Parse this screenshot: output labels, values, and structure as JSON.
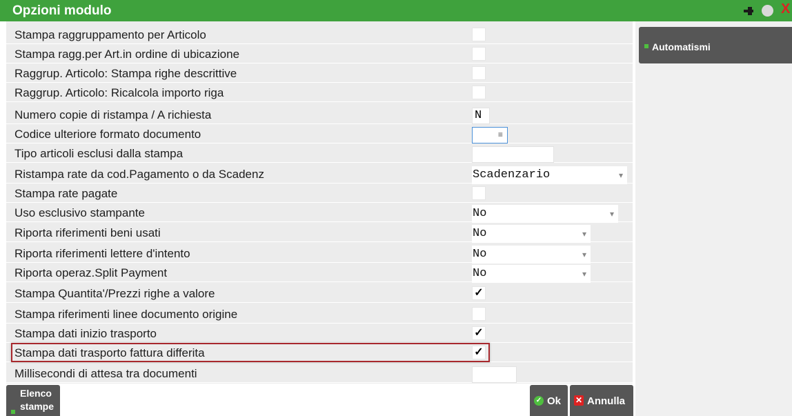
{
  "window": {
    "title": "Opzioni modulo"
  },
  "rows": [
    {
      "label": "Stampa raggruppamento per Articolo",
      "type": "checkbox",
      "checked": false
    },
    {
      "label": "Stampa ragg.per Art.in ordine di ubicazione",
      "type": "checkbox",
      "checked": false
    },
    {
      "label": "Raggrup. Articolo: Stampa righe descrittive",
      "type": "checkbox",
      "checked": false
    },
    {
      "label": "Raggrup. Articolo: Ricalcola importo riga",
      "type": "checkbox",
      "checked": false
    },
    {
      "label": "Numero copie di ristampa / A richiesta",
      "type": "text",
      "value": "N"
    },
    {
      "label": "Codice ulteriore formato documento",
      "type": "lookup",
      "value": ""
    },
    {
      "label": "Tipo articoli esclusi dalla stampa",
      "type": "text",
      "value": ""
    },
    {
      "label": "Ristampa rate da cod.Pagamento o da Scadenz",
      "type": "select",
      "value": "Scadenzario"
    },
    {
      "label": "Stampa rate pagate",
      "type": "checkbox",
      "checked": false
    },
    {
      "label": "Uso esclusivo stampante",
      "type": "select",
      "value": "No"
    },
    {
      "label": "Riporta riferimenti beni usati",
      "type": "select",
      "value": "No"
    },
    {
      "label": "Riporta riferimenti lettere d'intento",
      "type": "select",
      "value": "No"
    },
    {
      "label": "Riporta operaz.Split Payment",
      "type": "select",
      "value": "No"
    },
    {
      "label": "Stampa Quantita'/Prezzi righe a valore",
      "type": "checkbox",
      "checked": true
    },
    {
      "label": "Stampa riferimenti linee documento origine",
      "type": "checkbox",
      "checked": false
    },
    {
      "label": "Stampa dati inizio trasporto",
      "type": "checkbox",
      "checked": true
    },
    {
      "label": "Stampa dati trasporto fattura differita",
      "type": "checkbox",
      "checked": true
    },
    {
      "label": "Millisecondi di attesa tra documenti",
      "type": "text",
      "value": ""
    }
  ],
  "check_mark": "✓",
  "side": {
    "automatismi": "Automatismi"
  },
  "buttons": {
    "elenco_line1": "Elenco",
    "elenco_line2": "stampe",
    "ok": "Ok",
    "annulla": "Annulla"
  },
  "colors": {
    "titlebar": "#3fa23d",
    "button": "#565656",
    "highlight": "#a8282d"
  }
}
